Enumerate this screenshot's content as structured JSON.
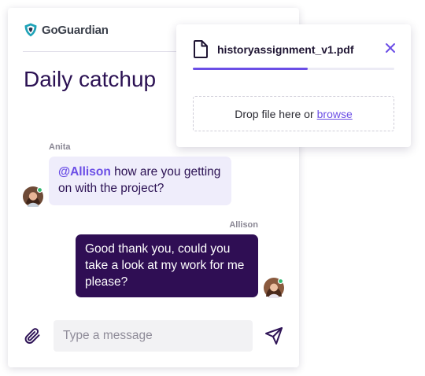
{
  "brand": {
    "name": "GoGuardian",
    "icon": "shield-icon"
  },
  "chat": {
    "title": "Daily catchup",
    "messages": [
      {
        "sender": "Anita",
        "mention": "@Allison",
        "text": " how are you getting on with the project?"
      },
      {
        "sender": "Allison",
        "text": "Good thank you, could you take a look at my work for me please?"
      }
    ],
    "composer": {
      "placeholder": "Type a message",
      "attach_icon": "paperclip-icon",
      "send_icon": "send-icon"
    }
  },
  "upload": {
    "file_name": "historyassignment_v1.pdf",
    "file_icon": "file-icon",
    "close_icon": "close-icon",
    "progress": 0.57,
    "drop_text": "Drop file here or",
    "browse_label": "browse"
  },
  "colors": {
    "accent": "#6b4ee6",
    "outgoing_bubble": "#2f0e54",
    "incoming_bubble": "#efedfb",
    "online_status": "#2fb86f"
  }
}
